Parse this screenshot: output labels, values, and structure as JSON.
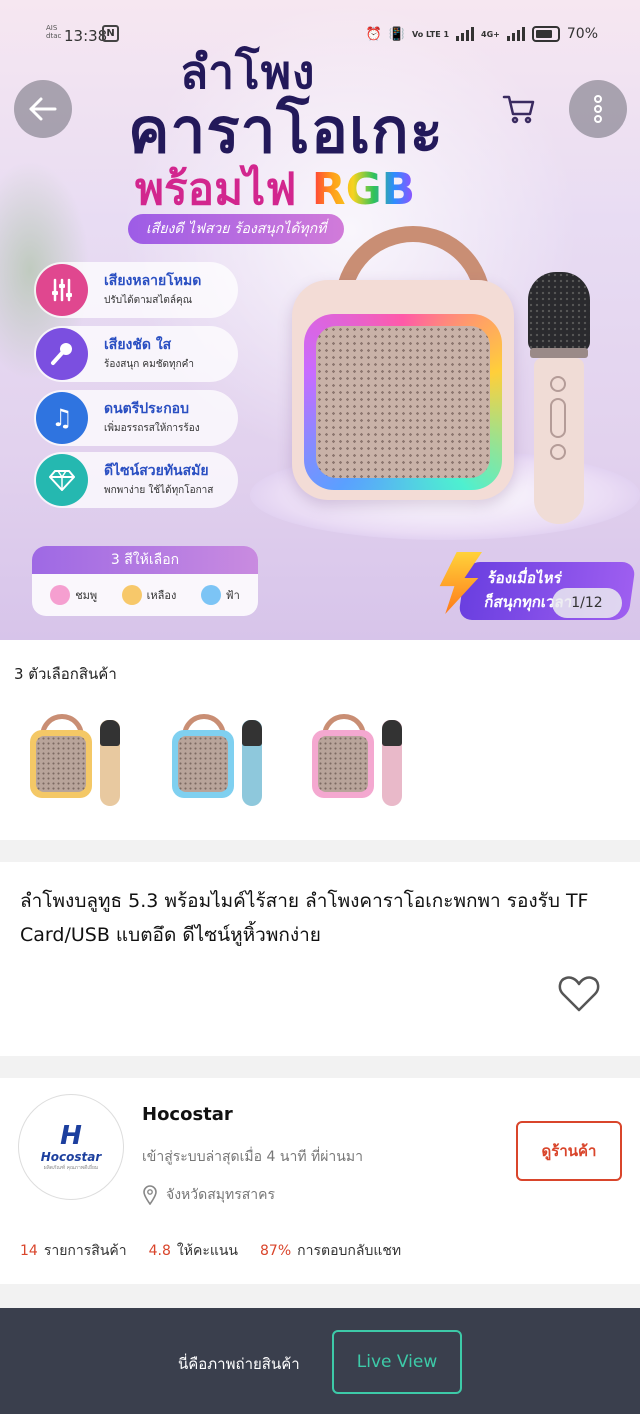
{
  "status_bar": {
    "carrier": "AIS dtac",
    "time": "13:38",
    "nfc": "N",
    "volte": "Vo LTE 1",
    "network": "4G+",
    "battery": "70%"
  },
  "hero": {
    "title_line1": "ลำโพง",
    "title_line2": "คาราโอเกะ",
    "title_line3_prefix": "พร้อมไฟ",
    "title_line3_rgb": "RGB",
    "tagline": "เสียงดี ไฟสวย ร้องสนุกได้ทุกที่",
    "features": [
      {
        "title": "เสียงหลายโหมด",
        "subtitle": "ปรับได้ตามสไตล์คุณ",
        "icon": "equalizer-icon",
        "color": "#e0478f"
      },
      {
        "title": "เสียงชัด ใส",
        "subtitle": "ร้องสนุก คมชัดทุกคำ",
        "icon": "microphone-icon",
        "color": "#7b4fe0"
      },
      {
        "title": "ดนตรีประกอบ",
        "subtitle": "เพิ่มอรรถรสให้การร้อง",
        "icon": "music-note-icon",
        "color": "#2f74e0"
      },
      {
        "title": "ดีไซน์สวยทันสมัย",
        "subtitle": "พกพาง่าย ใช้ได้ทุกโอกาส",
        "icon": "diamond-icon",
        "color": "#25b8b0"
      }
    ],
    "colors_title": "3 สีให้เลือก",
    "color_options": [
      {
        "label": "ชมพู",
        "color": "#f59fd0"
      },
      {
        "label": "เหลือง",
        "color": "#f7c86a"
      },
      {
        "label": "ฟ้า",
        "color": "#7cc4f5"
      }
    ],
    "promo_line1": "ร้องเมื่อไหร่",
    "promo_line2": "ก็สนุกทุกเวลา",
    "image_counter": "1/12"
  },
  "variants": {
    "label": "3 ตัวเลือกสินค้า",
    "items": [
      {
        "name": "yellow",
        "speaker_color": "#f4c866",
        "mic_color": "#e8c9a0"
      },
      {
        "name": "blue",
        "speaker_color": "#7fd0f0",
        "mic_color": "#8ec8dc"
      },
      {
        "name": "pink",
        "speaker_color": "#f4a8d0",
        "mic_color": "#e9b9c9"
      }
    ]
  },
  "product": {
    "title": "ลำโพงบลูทูธ 5.3 พร้อมไมค์ไร้สาย ลำโพงคาราโอเกะพกพา รองรับ TF Card/USB แบตอึด ดีไซน์หูหิ้วพกง่าย"
  },
  "shop": {
    "logo_mark": "H",
    "logo_name": "Hocostar",
    "logo_sub": "ผลิตภัณฑ์ คุณภาพดีเยี่ยม",
    "name": "Hocostar",
    "last_seen": "เข้าสู่ระบบล่าสุดเมื่อ 4 นาที ที่ผ่านมา",
    "location": "จังหวัดสมุทรสาคร",
    "visit_label": "ดูร้านค้า",
    "stats": [
      {
        "value": "14",
        "label": "รายการสินค้า"
      },
      {
        "value": "4.8",
        "label": "ให้คะแนน"
      },
      {
        "value": "87%",
        "label": "การตอบกลับแชท"
      }
    ]
  },
  "bottom_bar": {
    "text": "นี่คือภาพถ่ายสินค้า",
    "live_label": "Live View"
  },
  "colors": {
    "accent": "#d9452b",
    "live": "#3dcaa8",
    "bottom_bar": "#3a3f4d"
  }
}
